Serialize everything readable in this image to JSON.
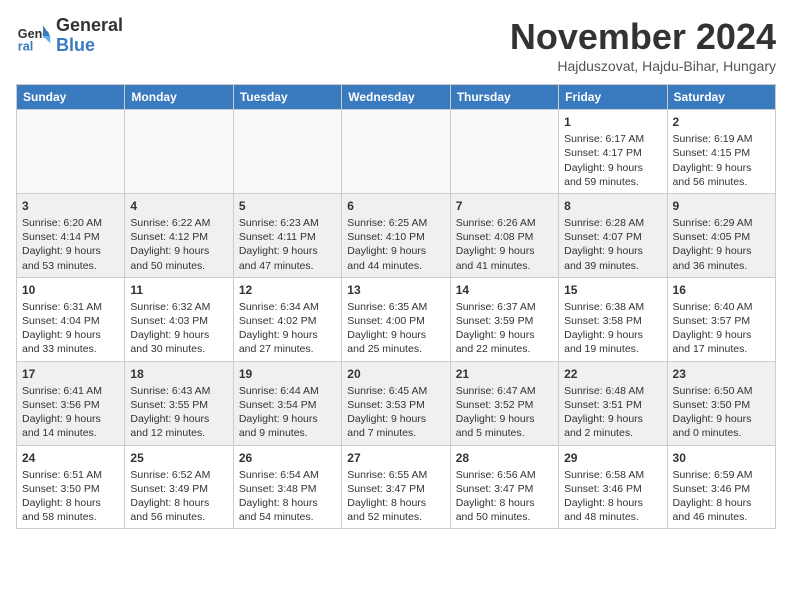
{
  "logo": {
    "text_general": "General",
    "text_blue": "Blue"
  },
  "header": {
    "month": "November 2024",
    "location": "Hajduszovat, Hajdu-Bihar, Hungary"
  },
  "days_of_week": [
    "Sunday",
    "Monday",
    "Tuesday",
    "Wednesday",
    "Thursday",
    "Friday",
    "Saturday"
  ],
  "weeks": [
    [
      {
        "day": "",
        "info": ""
      },
      {
        "day": "",
        "info": ""
      },
      {
        "day": "",
        "info": ""
      },
      {
        "day": "",
        "info": ""
      },
      {
        "day": "",
        "info": ""
      },
      {
        "day": "1",
        "info": "Sunrise: 6:17 AM\nSunset: 4:17 PM\nDaylight: 9 hours and 59 minutes."
      },
      {
        "day": "2",
        "info": "Sunrise: 6:19 AM\nSunset: 4:15 PM\nDaylight: 9 hours and 56 minutes."
      }
    ],
    [
      {
        "day": "3",
        "info": "Sunrise: 6:20 AM\nSunset: 4:14 PM\nDaylight: 9 hours and 53 minutes."
      },
      {
        "day": "4",
        "info": "Sunrise: 6:22 AM\nSunset: 4:12 PM\nDaylight: 9 hours and 50 minutes."
      },
      {
        "day": "5",
        "info": "Sunrise: 6:23 AM\nSunset: 4:11 PM\nDaylight: 9 hours and 47 minutes."
      },
      {
        "day": "6",
        "info": "Sunrise: 6:25 AM\nSunset: 4:10 PM\nDaylight: 9 hours and 44 minutes."
      },
      {
        "day": "7",
        "info": "Sunrise: 6:26 AM\nSunset: 4:08 PM\nDaylight: 9 hours and 41 minutes."
      },
      {
        "day": "8",
        "info": "Sunrise: 6:28 AM\nSunset: 4:07 PM\nDaylight: 9 hours and 39 minutes."
      },
      {
        "day": "9",
        "info": "Sunrise: 6:29 AM\nSunset: 4:05 PM\nDaylight: 9 hours and 36 minutes."
      }
    ],
    [
      {
        "day": "10",
        "info": "Sunrise: 6:31 AM\nSunset: 4:04 PM\nDaylight: 9 hours and 33 minutes."
      },
      {
        "day": "11",
        "info": "Sunrise: 6:32 AM\nSunset: 4:03 PM\nDaylight: 9 hours and 30 minutes."
      },
      {
        "day": "12",
        "info": "Sunrise: 6:34 AM\nSunset: 4:02 PM\nDaylight: 9 hours and 27 minutes."
      },
      {
        "day": "13",
        "info": "Sunrise: 6:35 AM\nSunset: 4:00 PM\nDaylight: 9 hours and 25 minutes."
      },
      {
        "day": "14",
        "info": "Sunrise: 6:37 AM\nSunset: 3:59 PM\nDaylight: 9 hours and 22 minutes."
      },
      {
        "day": "15",
        "info": "Sunrise: 6:38 AM\nSunset: 3:58 PM\nDaylight: 9 hours and 19 minutes."
      },
      {
        "day": "16",
        "info": "Sunrise: 6:40 AM\nSunset: 3:57 PM\nDaylight: 9 hours and 17 minutes."
      }
    ],
    [
      {
        "day": "17",
        "info": "Sunrise: 6:41 AM\nSunset: 3:56 PM\nDaylight: 9 hours and 14 minutes."
      },
      {
        "day": "18",
        "info": "Sunrise: 6:43 AM\nSunset: 3:55 PM\nDaylight: 9 hours and 12 minutes."
      },
      {
        "day": "19",
        "info": "Sunrise: 6:44 AM\nSunset: 3:54 PM\nDaylight: 9 hours and 9 minutes."
      },
      {
        "day": "20",
        "info": "Sunrise: 6:45 AM\nSunset: 3:53 PM\nDaylight: 9 hours and 7 minutes."
      },
      {
        "day": "21",
        "info": "Sunrise: 6:47 AM\nSunset: 3:52 PM\nDaylight: 9 hours and 5 minutes."
      },
      {
        "day": "22",
        "info": "Sunrise: 6:48 AM\nSunset: 3:51 PM\nDaylight: 9 hours and 2 minutes."
      },
      {
        "day": "23",
        "info": "Sunrise: 6:50 AM\nSunset: 3:50 PM\nDaylight: 9 hours and 0 minutes."
      }
    ],
    [
      {
        "day": "24",
        "info": "Sunrise: 6:51 AM\nSunset: 3:50 PM\nDaylight: 8 hours and 58 minutes."
      },
      {
        "day": "25",
        "info": "Sunrise: 6:52 AM\nSunset: 3:49 PM\nDaylight: 8 hours and 56 minutes."
      },
      {
        "day": "26",
        "info": "Sunrise: 6:54 AM\nSunset: 3:48 PM\nDaylight: 8 hours and 54 minutes."
      },
      {
        "day": "27",
        "info": "Sunrise: 6:55 AM\nSunset: 3:47 PM\nDaylight: 8 hours and 52 minutes."
      },
      {
        "day": "28",
        "info": "Sunrise: 6:56 AM\nSunset: 3:47 PM\nDaylight: 8 hours and 50 minutes."
      },
      {
        "day": "29",
        "info": "Sunrise: 6:58 AM\nSunset: 3:46 PM\nDaylight: 8 hours and 48 minutes."
      },
      {
        "day": "30",
        "info": "Sunrise: 6:59 AM\nSunset: 3:46 PM\nDaylight: 8 hours and 46 minutes."
      }
    ]
  ]
}
